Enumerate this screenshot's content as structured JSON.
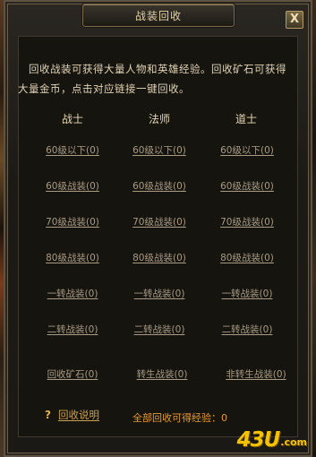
{
  "window": {
    "title": "战装回收",
    "close_label": "X"
  },
  "intro_text": "回收战装可获得大量人物和英雄经验。回收矿石可获得大量金币，点击对应链接一键回收。",
  "columns": [
    "战士",
    "法师",
    "道士"
  ],
  "rows": [
    [
      "60级以下(0)",
      "60级以下(0)",
      "60级以下(0)"
    ],
    [
      "60级战装(0)",
      "60级战装(0)",
      "60级战装(0)"
    ],
    [
      "70级战装(0)",
      "70级战装(0)",
      "70级战装(0)"
    ],
    [
      "80级战装(0)",
      "80级战装(0)",
      "80级战装(0)"
    ],
    [
      "一转战装(0)",
      "一转战装(0)",
      "一转战装(0)"
    ],
    [
      "二转战装(0)",
      "二转战装(0)",
      "二转战装(0)"
    ]
  ],
  "bottom_row": [
    "回收矿石(0)",
    "转生战装(0)",
    "非转生战装(0)"
  ],
  "help": {
    "icon": "question-icon",
    "icon_glyph": "?",
    "label": "回收说明"
  },
  "total_label": "全部回收可得经验：0",
  "watermark": {
    "main": "43U",
    "suffix": ".com"
  },
  "colors": {
    "link": "#a89a84",
    "header": "#e6d6b2",
    "total": "#e89a2a",
    "help_link": "#c9a050"
  }
}
